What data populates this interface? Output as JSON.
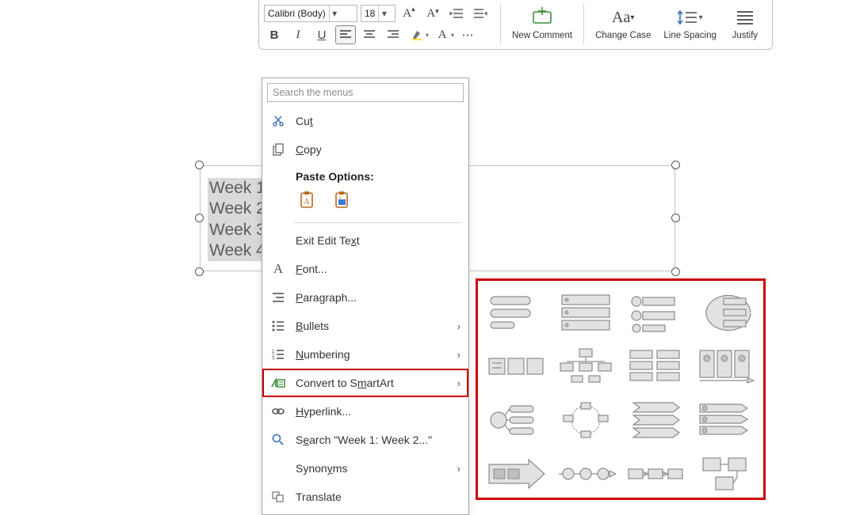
{
  "ribbon": {
    "font_name": "Calibri (Body)",
    "font_size": "18",
    "new_comment": "New Comment",
    "change_case": "Change Case",
    "line_spacing": "Line Spacing",
    "justify": "Justify"
  },
  "textbox": {
    "lines": [
      "Week 1",
      "Week 2",
      "Week 3",
      "Week 4"
    ]
  },
  "context_menu": {
    "search_placeholder": "Search the menus",
    "cut_html": "Cu<u>t</u>",
    "copy_html": "<u>C</u>opy",
    "paste_heading": "Paste Options:",
    "exit_edit_html": "Exit Edit Te<u>x</u>t",
    "font_html": "<u>F</u>ont...",
    "paragraph_html": "<u>P</u>aragraph...",
    "bullets_html": "<u>B</u>ullets",
    "numbering_html": "<u>N</u>umbering",
    "smartart_html": "Convert to S<u>m</u>artArt",
    "hyperlink_html": "<u>H</u>yperlink...",
    "search_item_html": "S<u>e</u>arch \"Week 1: Week 2...\"",
    "synonyms_html": "Synon<u>y</u>ms",
    "translate_html": "Translate"
  },
  "icons": {
    "scissors": "scissors-icon",
    "copy": "copy-icon",
    "clipboard": "clipboard-icon",
    "font_a": "font-a-icon",
    "paragraph": "paragraph-icon",
    "bullets": "bullets-icon",
    "numbering": "numbering-icon",
    "smartart": "smartart-icon",
    "link": "link-icon",
    "search": "search-icon",
    "translate": "translate-icon"
  },
  "gallery": {
    "count": 16
  }
}
